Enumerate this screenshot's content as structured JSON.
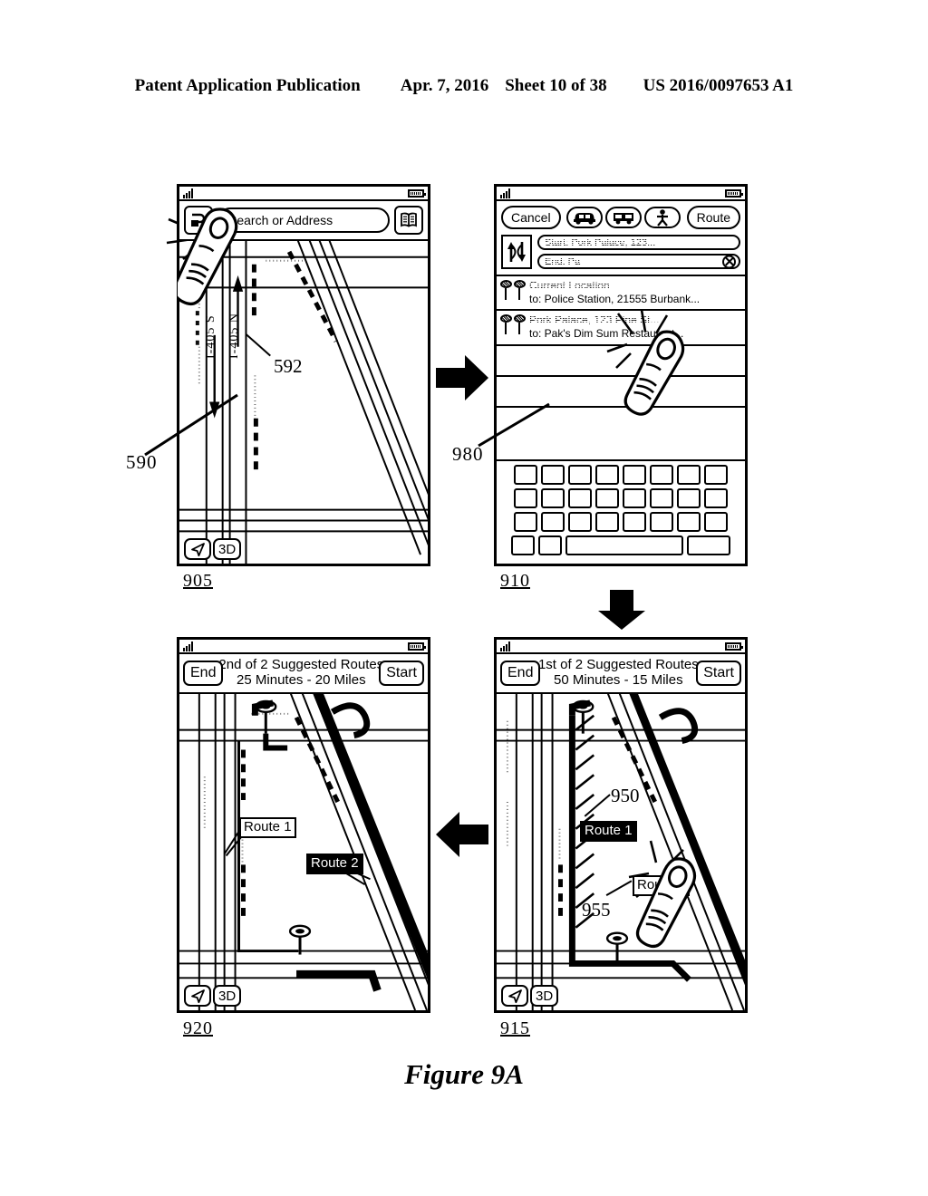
{
  "header": {
    "publication": "Patent Application Publication",
    "date": "Apr. 7, 2016",
    "sheet": "Sheet 10 of 38",
    "docnum": "US 2016/0097653 A1"
  },
  "figure": {
    "caption": "Figure 9A"
  },
  "reference_numerals": {
    "n590": "590",
    "n592": "592",
    "n980": "980",
    "n950": "950",
    "n955": "955"
  },
  "panels": {
    "p905": {
      "label": "905",
      "status_bar": {
        "signal_icon": "signal-bars-icon",
        "battery_icon": "battery-icon"
      },
      "search": {
        "directions_button": "directions-icon",
        "placeholder": "Search or Address",
        "bookmark_button": "bookmark-book-icon"
      },
      "map": {
        "road_label_south": "I-405 S",
        "road_label_north": "I-405 N",
        "locate_button": "navigation-arrow-icon",
        "threed_button": "3D"
      }
    },
    "p910": {
      "label": "910",
      "status_bar": {
        "signal_icon": "signal-bars-icon",
        "battery_icon": "battery-icon"
      },
      "toolbar": {
        "cancel": "Cancel",
        "mode_car": "car-icon",
        "mode_transit": "bus-icon",
        "mode_walk": "pedestrian-icon",
        "route": "Route"
      },
      "entry": {
        "swap_button": "swap-arrows-icon",
        "start_value": "Start: Pork Palace, 123...",
        "end_value": "End: Pa",
        "clear_button": "clear-circle-x-icon"
      },
      "recents": [
        {
          "icon": "double-pin-icon",
          "line1": "Current Location",
          "line2": "to: Police Station, 21555 Burbank...",
          "line1_dimmed": true
        },
        {
          "icon": "double-pin-icon",
          "line1": "Pork Palace, 123 Pine St...",
          "line2": "to: Pak's Dim Sum Restaurant...",
          "line1_dimmed": true
        }
      ],
      "keyboard": {
        "row1_keys": 8,
        "row2_keys": 8,
        "row3_keys": 8,
        "row4": [
          "key",
          "key",
          "space",
          "key"
        ]
      }
    },
    "p920": {
      "label": "920",
      "status_bar": {
        "signal_icon": "signal-bars-icon",
        "battery_icon": "battery-icon"
      },
      "header": {
        "end_button": "End",
        "title_line1": "2nd of 2 Suggested Routes",
        "title_line2": "25 Minutes - 20 Miles",
        "start_button": "Start"
      },
      "map": {
        "route1_badge": "Route 1",
        "route1_selected": false,
        "route2_badge": "Route 2",
        "route2_selected": true,
        "locate_button": "navigation-arrow-icon",
        "threed_button": "3D"
      }
    },
    "p915": {
      "label": "915",
      "status_bar": {
        "signal_icon": "signal-bars-icon",
        "battery_icon": "battery-icon"
      },
      "header": {
        "end_button": "End",
        "title_line1": "1st of 2 Suggested Routes",
        "title_line2": "50 Minutes - 15 Miles",
        "start_button": "Start"
      },
      "map": {
        "route1_badge": "Route 1",
        "route1_selected": true,
        "route2_badge": "Route 2",
        "route2_selected": false,
        "locate_button": "navigation-arrow-icon",
        "threed_button": "3D"
      }
    }
  }
}
